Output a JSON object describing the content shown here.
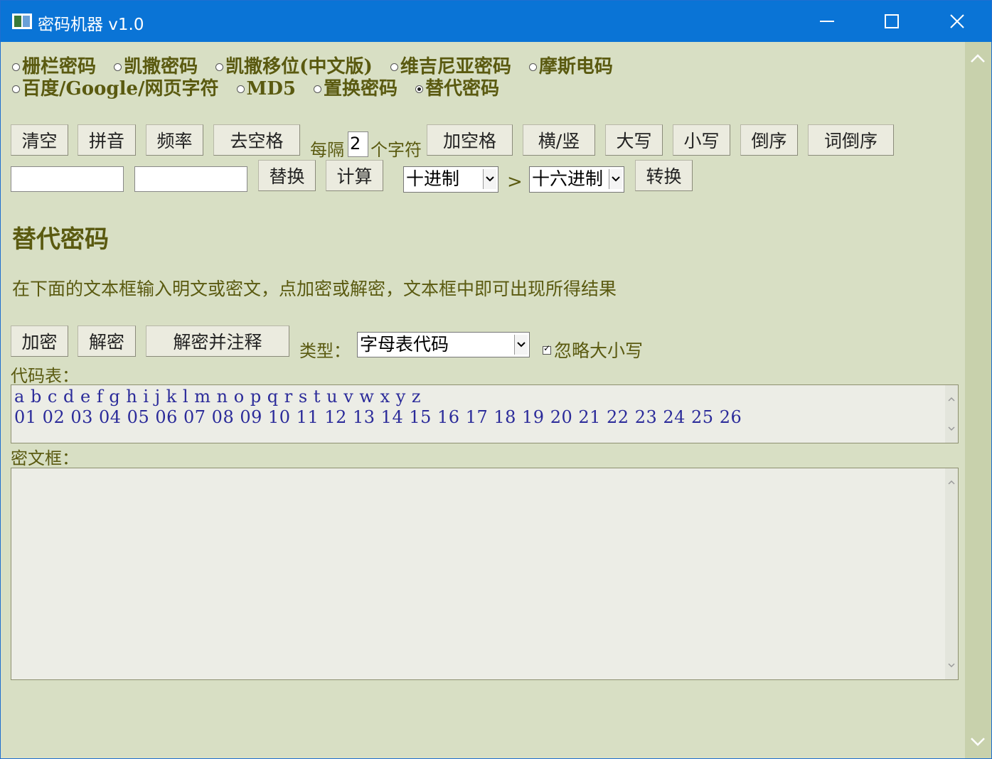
{
  "window": {
    "title": "密码机器 v1.0",
    "controls": [
      "minimize-icon",
      "maximize-icon",
      "close-icon"
    ]
  },
  "modes": {
    "row1": [
      {
        "label": "栅栏密码",
        "selected": false
      },
      {
        "label": "凯撒密码",
        "selected": false
      },
      {
        "label": "凯撒移位(中文版)",
        "selected": false
      },
      {
        "label": "维吉尼亚密码",
        "selected": false
      },
      {
        "label": "摩斯电码",
        "selected": false
      }
    ],
    "row2": [
      {
        "label": "百度/Google/网页字符",
        "selected": false
      },
      {
        "label": "MD5",
        "selected": false
      },
      {
        "label": "置换密码",
        "selected": false
      },
      {
        "label": "替代密码",
        "selected": true
      }
    ]
  },
  "toolbar": {
    "clear": "清空",
    "pinyin": "拼音",
    "frequency": "频率",
    "remove_spaces": "去空格",
    "every_label": "每隔",
    "every_value": "2",
    "chars_label": "个字符",
    "add_spaces": "加空格",
    "horiz_vert": "横/竖",
    "upper": "大写",
    "lower": "小写",
    "reverse": "倒序",
    "word_reverse": "词倒序"
  },
  "replace_row": {
    "find_value": "",
    "replace_value": "",
    "replace": "替换",
    "calculate": "计算",
    "from_base": "十进制",
    "arrow": ">",
    "to_base": "十六进制",
    "convert": "转换"
  },
  "section": {
    "heading": "替代密码",
    "description": "在下面的文本框输入明文或密文，点加密或解密，文本框中即可出现所得结果"
  },
  "actions": {
    "encrypt": "加密",
    "decrypt": "解密",
    "decrypt_annotate": "解密并注释",
    "type_label": "类型：",
    "type_value": "字母表代码",
    "ignore_case_label": "忽略大小写",
    "ignore_case_checked": true
  },
  "code_table": {
    "label": "代码表：",
    "line1": "a b c d e f g h i j k l m n o p q r s t u v w x y z",
    "line2": "01 02 03 04 05 06 07 08 09 10 11 12 13 14 15 16 17 18 19 20 21 22 23 24 25 26"
  },
  "cipher_box": {
    "label": "密文框：",
    "value": ""
  }
}
